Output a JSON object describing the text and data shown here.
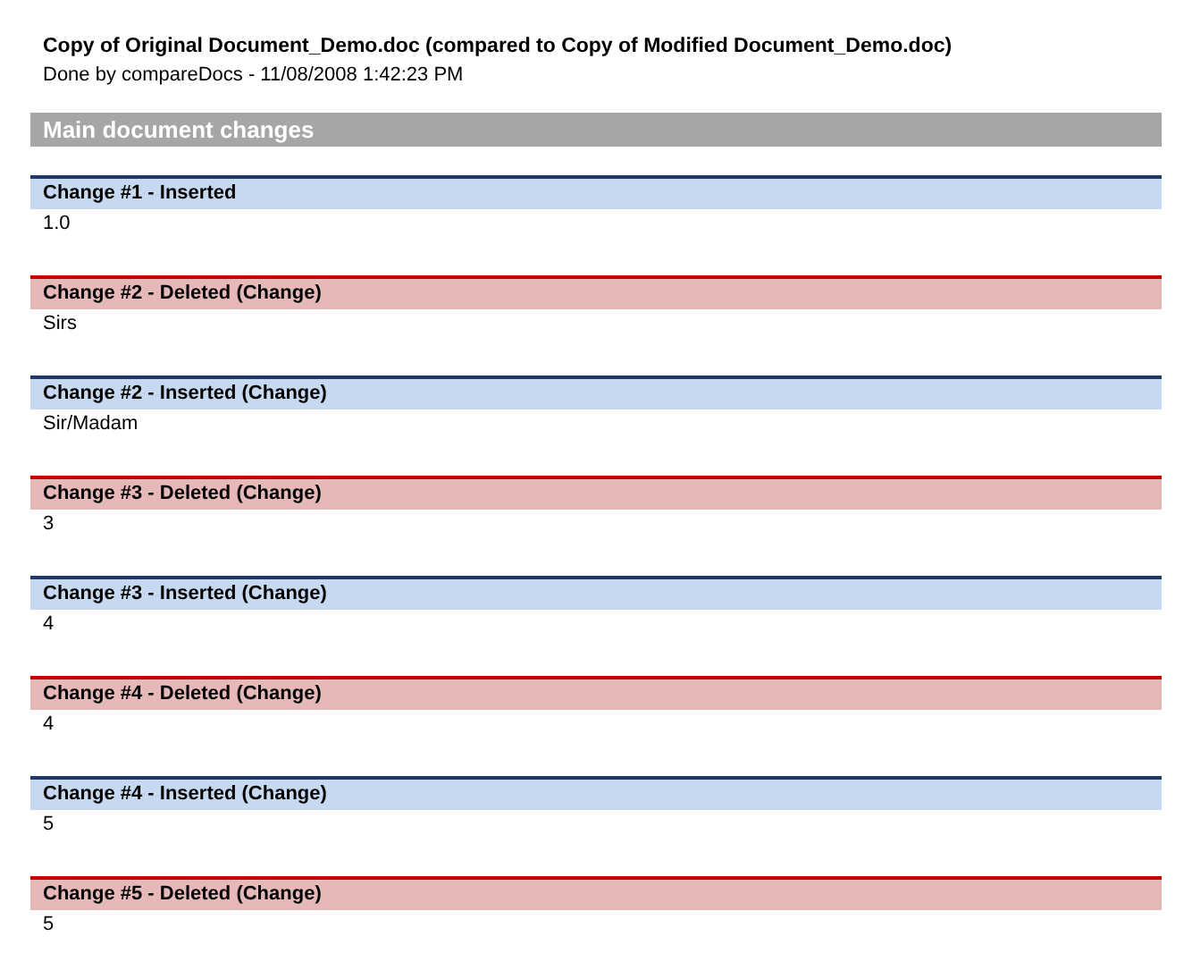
{
  "title": "Copy of Original Document_Demo.doc (compared to Copy of Modified Document_Demo.doc)",
  "subtitle": "Done by compareDocs - 11/08/2008 1:42:23 PM",
  "section": {
    "heading": "Main document changes",
    "changes": [
      {
        "kind": "inserted",
        "heading": "Change #1 - Inserted",
        "text": "1.0"
      },
      {
        "kind": "deleted",
        "heading": "Change #2 - Deleted (Change)",
        "text": "Sirs"
      },
      {
        "kind": "inserted",
        "heading": "Change #2 - Inserted (Change)",
        "text": "Sir/Madam"
      },
      {
        "kind": "deleted",
        "heading": "Change #3 - Deleted (Change)",
        "text": "3"
      },
      {
        "kind": "inserted",
        "heading": "Change #3 - Inserted (Change)",
        "text": "4"
      },
      {
        "kind": "deleted",
        "heading": "Change #4 - Deleted (Change)",
        "text": "4"
      },
      {
        "kind": "inserted",
        "heading": "Change #4 - Inserted (Change)",
        "text": "5"
      },
      {
        "kind": "deleted",
        "heading": "Change #5 - Deleted (Change)",
        "text": "5"
      }
    ]
  }
}
